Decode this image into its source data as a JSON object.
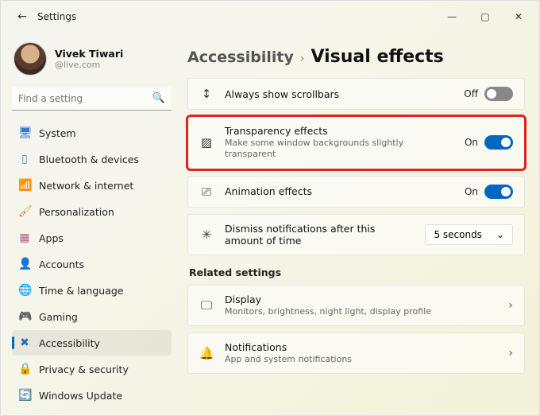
{
  "window": {
    "title": "Settings"
  },
  "profile": {
    "name": "Vivek Tiwari",
    "email": "@live.com"
  },
  "search": {
    "placeholder": "Find a setting"
  },
  "sidebar": {
    "items": [
      {
        "label": "System",
        "icon": "🖥"
      },
      {
        "label": "Bluetooth & devices",
        "icon": "▯"
      },
      {
        "label": "Network & internet",
        "icon": "📶"
      },
      {
        "label": "Personalization",
        "icon": "🖌"
      },
      {
        "label": "Apps",
        "icon": "▦"
      },
      {
        "label": "Accounts",
        "icon": "👤"
      },
      {
        "label": "Time & language",
        "icon": "🌐"
      },
      {
        "label": "Gaming",
        "icon": "🎮"
      },
      {
        "label": "Accessibility",
        "icon": "✖"
      },
      {
        "label": "Privacy & security",
        "icon": "🔒"
      },
      {
        "label": "Windows Update",
        "icon": "🔄"
      }
    ],
    "active_index": 8
  },
  "breadcrumb": {
    "parent": "Accessibility",
    "current": "Visual effects"
  },
  "cards": {
    "scrollbars": {
      "title": "Always show scrollbars",
      "state": "Off",
      "on": false
    },
    "transparency": {
      "title": "Transparency effects",
      "sub": "Make some window backgrounds slightly transparent",
      "state": "On",
      "on": true
    },
    "animation": {
      "title": "Animation effects",
      "state": "On",
      "on": true
    },
    "dismiss": {
      "title": "Dismiss notifications after this amount of time",
      "value": "5 seconds"
    }
  },
  "related": {
    "heading": "Related settings",
    "display": {
      "title": "Display",
      "sub": "Monitors, brightness, night light, display profile"
    },
    "notifications": {
      "title": "Notifications",
      "sub": "App and system notifications"
    }
  }
}
